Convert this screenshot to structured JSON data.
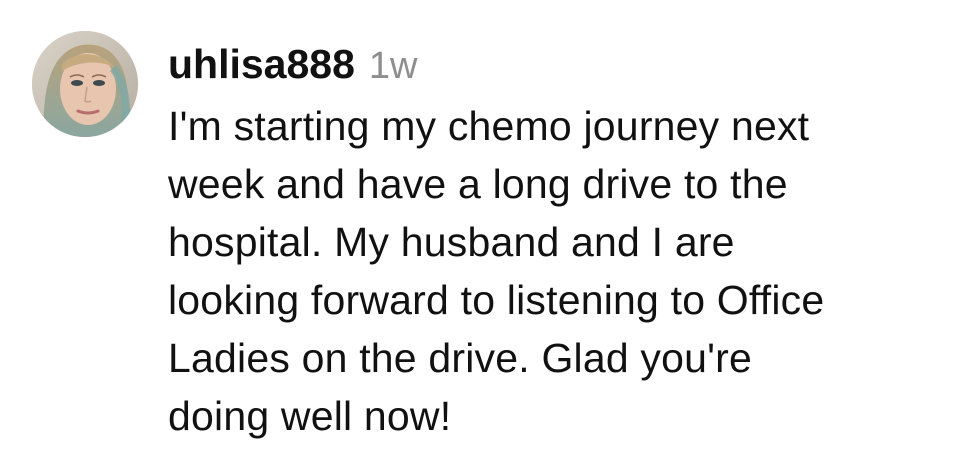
{
  "comment": {
    "avatar_icon": "user-avatar-photo",
    "username": "uhlisa888",
    "timestamp": "1w",
    "text_lines": [
      "I'm starting my chemo journey next",
      "week and have a long drive to the",
      "hospital. My husband and I are",
      "looking forward to listening to Office",
      "Ladies on the drive. Glad you're",
      "doing well now!"
    ]
  },
  "colors": {
    "text": "#111111",
    "timestamp": "#8e8e8e",
    "background": "#ffffff"
  }
}
